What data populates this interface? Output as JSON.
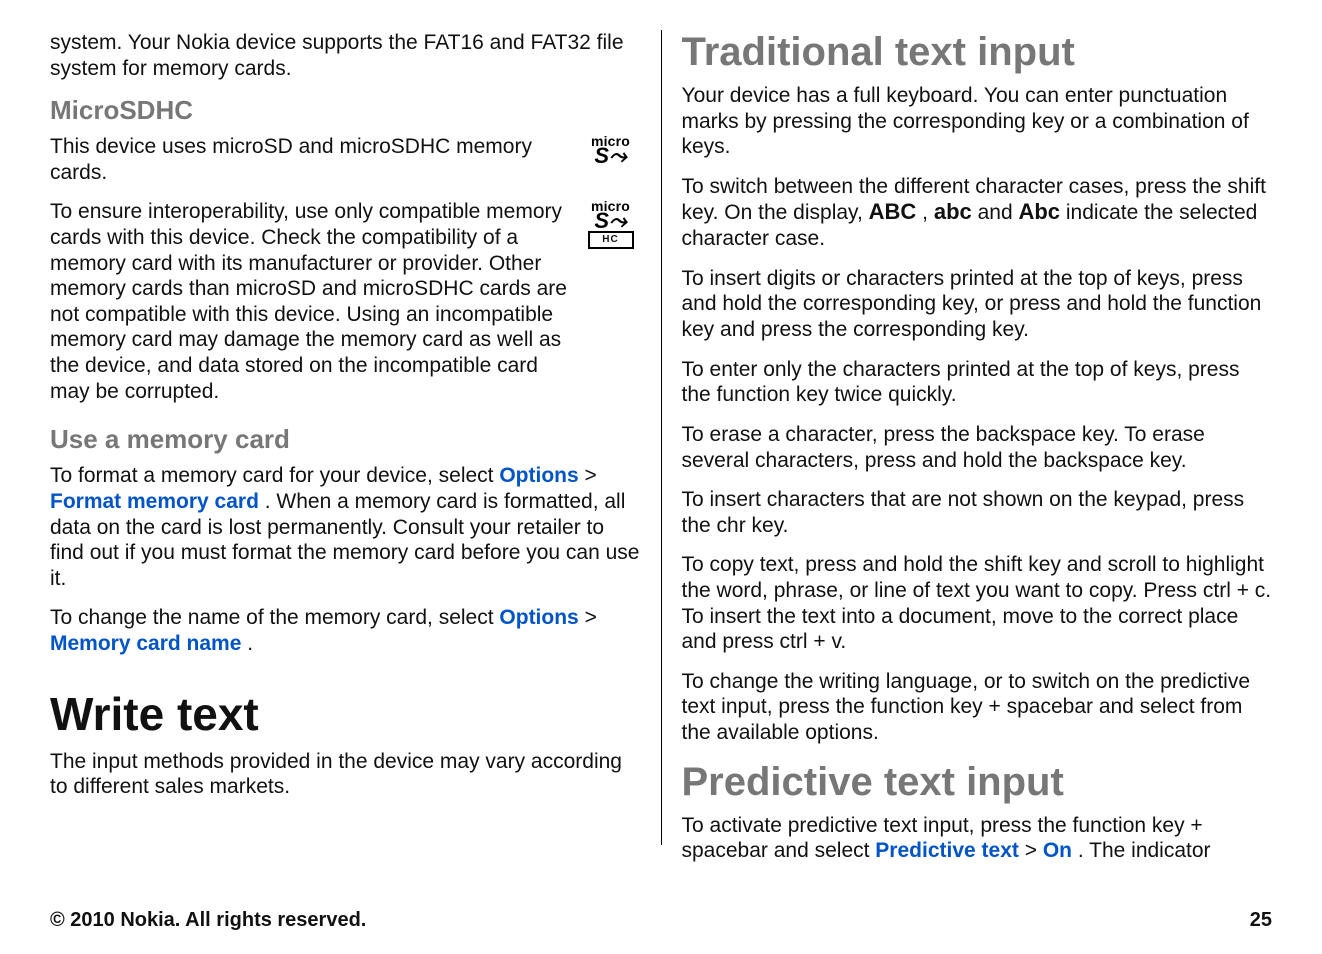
{
  "left": {
    "p1": "system. Your Nokia device supports the FAT16 and FAT32 file system for memory cards.",
    "h_microsdhc": "MicroSDHC",
    "p2": "This device uses microSD and microSDHC memory cards.",
    "p3": "To ensure interoperability, use only compatible memory cards with this device. Check the compatibility of a memory card with its manufacturer or provider. Other memory cards than microSD and microSDHC cards are not compatible with this device. Using an incompatible memory card may damage the memory card as well as the device, and data stored on the incompatible card may be corrupted.",
    "h_use_card": "Use a memory card",
    "p4_a": "To format a memory card for your device, select ",
    "p4_link1": "Options",
    "p4_sep": "  >  ",
    "p4_link2": "Format memory card",
    "p4_b": ". When a memory card is formatted, all data on the card is lost permanently. Consult your retailer to find out if you must format the memory card before you can use it.",
    "p5_a": "To change the name of the memory card, select ",
    "p5_link1": "Options",
    "p5_sep": "  >  ",
    "p5_link2": "Memory card name",
    "p5_b": ".",
    "h_write": "Write text",
    "p6": "The input methods provided in the device may vary according to different sales markets."
  },
  "right": {
    "h_trad": "Traditional text input",
    "p1": "Your device has a full keyboard. You can enter punctuation marks by pressing the corresponding key or a combination of keys.",
    "p2_a": "To switch between the different character cases, press the shift key. On the display, ",
    "p2_abc1": "ABC",
    "p2_sep1": ", ",
    "p2_abc2": "abc",
    "p2_sep2": " and ",
    "p2_abc3": "Abc",
    "p2_b": " indicate the selected character case.",
    "p3": "To insert digits or characters printed at the top of keys, press and hold the corresponding key, or press and hold the function key and press the corresponding key.",
    "p4": "To enter only the characters printed at the top of keys, press the function key twice quickly.",
    "p5": "To erase a character, press the backspace key. To erase several characters, press and hold the backspace key.",
    "p6": "To insert characters that are not shown on the keypad, press the chr key.",
    "p7": "To copy text, press and hold the shift key and scroll to highlight the word, phrase, or line of text you want to copy. Press ctrl + c. To insert the text into a document, move to the correct place and press ctrl + v.",
    "p8": "To change the writing language, or to switch on the predictive text input, press the function key + spacebar and select from the available options.",
    "h_pred": "Predictive text input",
    "p9_a": "To activate predictive text input, press the function key + spacebar and select ",
    "p9_link1": "Predictive text",
    "p9_sep": "  >  ",
    "p9_link2": "On",
    "p9_b": ". The indicator"
  },
  "icons": {
    "micro_word": "micro",
    "sd_word": "S≥",
    "hc_word": "HC"
  },
  "footer": {
    "copyright": "© 2010 Nokia. All rights reserved.",
    "page_no": "25"
  }
}
